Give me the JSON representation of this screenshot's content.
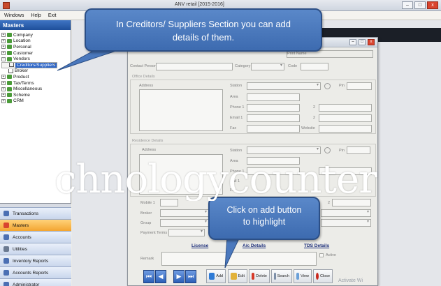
{
  "window": {
    "title": "ANV retail [2015-2016]",
    "buttons": [
      "–",
      "□",
      "x"
    ]
  },
  "menu": [
    "Windows",
    "Help",
    "Exit"
  ],
  "sidebar": {
    "header": "Masters",
    "tree": [
      {
        "label": "Company",
        "level": 0,
        "expand": "+"
      },
      {
        "label": "Location",
        "level": 0,
        "expand": "+"
      },
      {
        "label": "Personal",
        "level": 0,
        "expand": "+"
      },
      {
        "label": "Customer",
        "level": 0,
        "expand": "+"
      },
      {
        "label": "Vendors",
        "level": 0,
        "expand": "–"
      },
      {
        "label": "Creditors/Suppliers",
        "level": 1,
        "selected": true
      },
      {
        "label": "Transporter",
        "level": 1
      },
      {
        "label": "Broker",
        "level": 1
      },
      {
        "label": "Product",
        "level": 0,
        "expand": "+"
      },
      {
        "label": "Tax/Terms",
        "level": 0,
        "expand": "+"
      },
      {
        "label": "Miscellaneous",
        "level": 0,
        "expand": "+"
      },
      {
        "label": "Scheme",
        "level": 0,
        "expand": "+"
      },
      {
        "label": "CRM",
        "level": 0,
        "expand": "+"
      }
    ],
    "nav": [
      {
        "label": "Transactions",
        "color": "#4b6fb3"
      },
      {
        "label": "Masters",
        "color": "#d9452f",
        "active": true
      },
      {
        "label": "Accounts",
        "color": "#4b6fb3"
      },
      {
        "label": "Utilities",
        "color": "#6b7a91"
      },
      {
        "label": "Inventory Reports",
        "color": "#4b6fb3"
      },
      {
        "label": "Accounts Reports",
        "color": "#4b6fb3"
      },
      {
        "label": "Administrator",
        "color": "#4b6fb3"
      }
    ]
  },
  "form": {
    "print_name": "Print Name",
    "contact_person": "Contact Person",
    "category": "Category",
    "code": "Code",
    "office_details": "Office Details",
    "residence_details": "Residence Details",
    "address": "Address",
    "station": "Station",
    "pin": "Pin",
    "area": "Area",
    "phone1": "Phone 1",
    "two": "2",
    "email1": "Email 1",
    "fax": "Fax",
    "website": "Website",
    "email1_short": "ail 1",
    "fax_short": "Fax",
    "mobile1": "Mobile 1",
    "broker": "Broker",
    "group": "Group",
    "payment_terms": "Payment Terms",
    "remark": "Remark",
    "active": "Active",
    "license": "License",
    "ac_details": "A/c Details",
    "tds_details": "TDS Details"
  },
  "toolbar": {
    "add": "Add",
    "edit": "Edit",
    "delete": "Delete",
    "search": "Search",
    "view": "View",
    "close": "Close"
  },
  "callouts": {
    "top_line1": "In Creditors/ Suppliers Section you can add",
    "top_line2": "details of them.",
    "bottom_line1": "Click on add button",
    "bottom_line2": "to highlight"
  },
  "watermark": "chnologycounter",
  "activate": "Activate Wi"
}
